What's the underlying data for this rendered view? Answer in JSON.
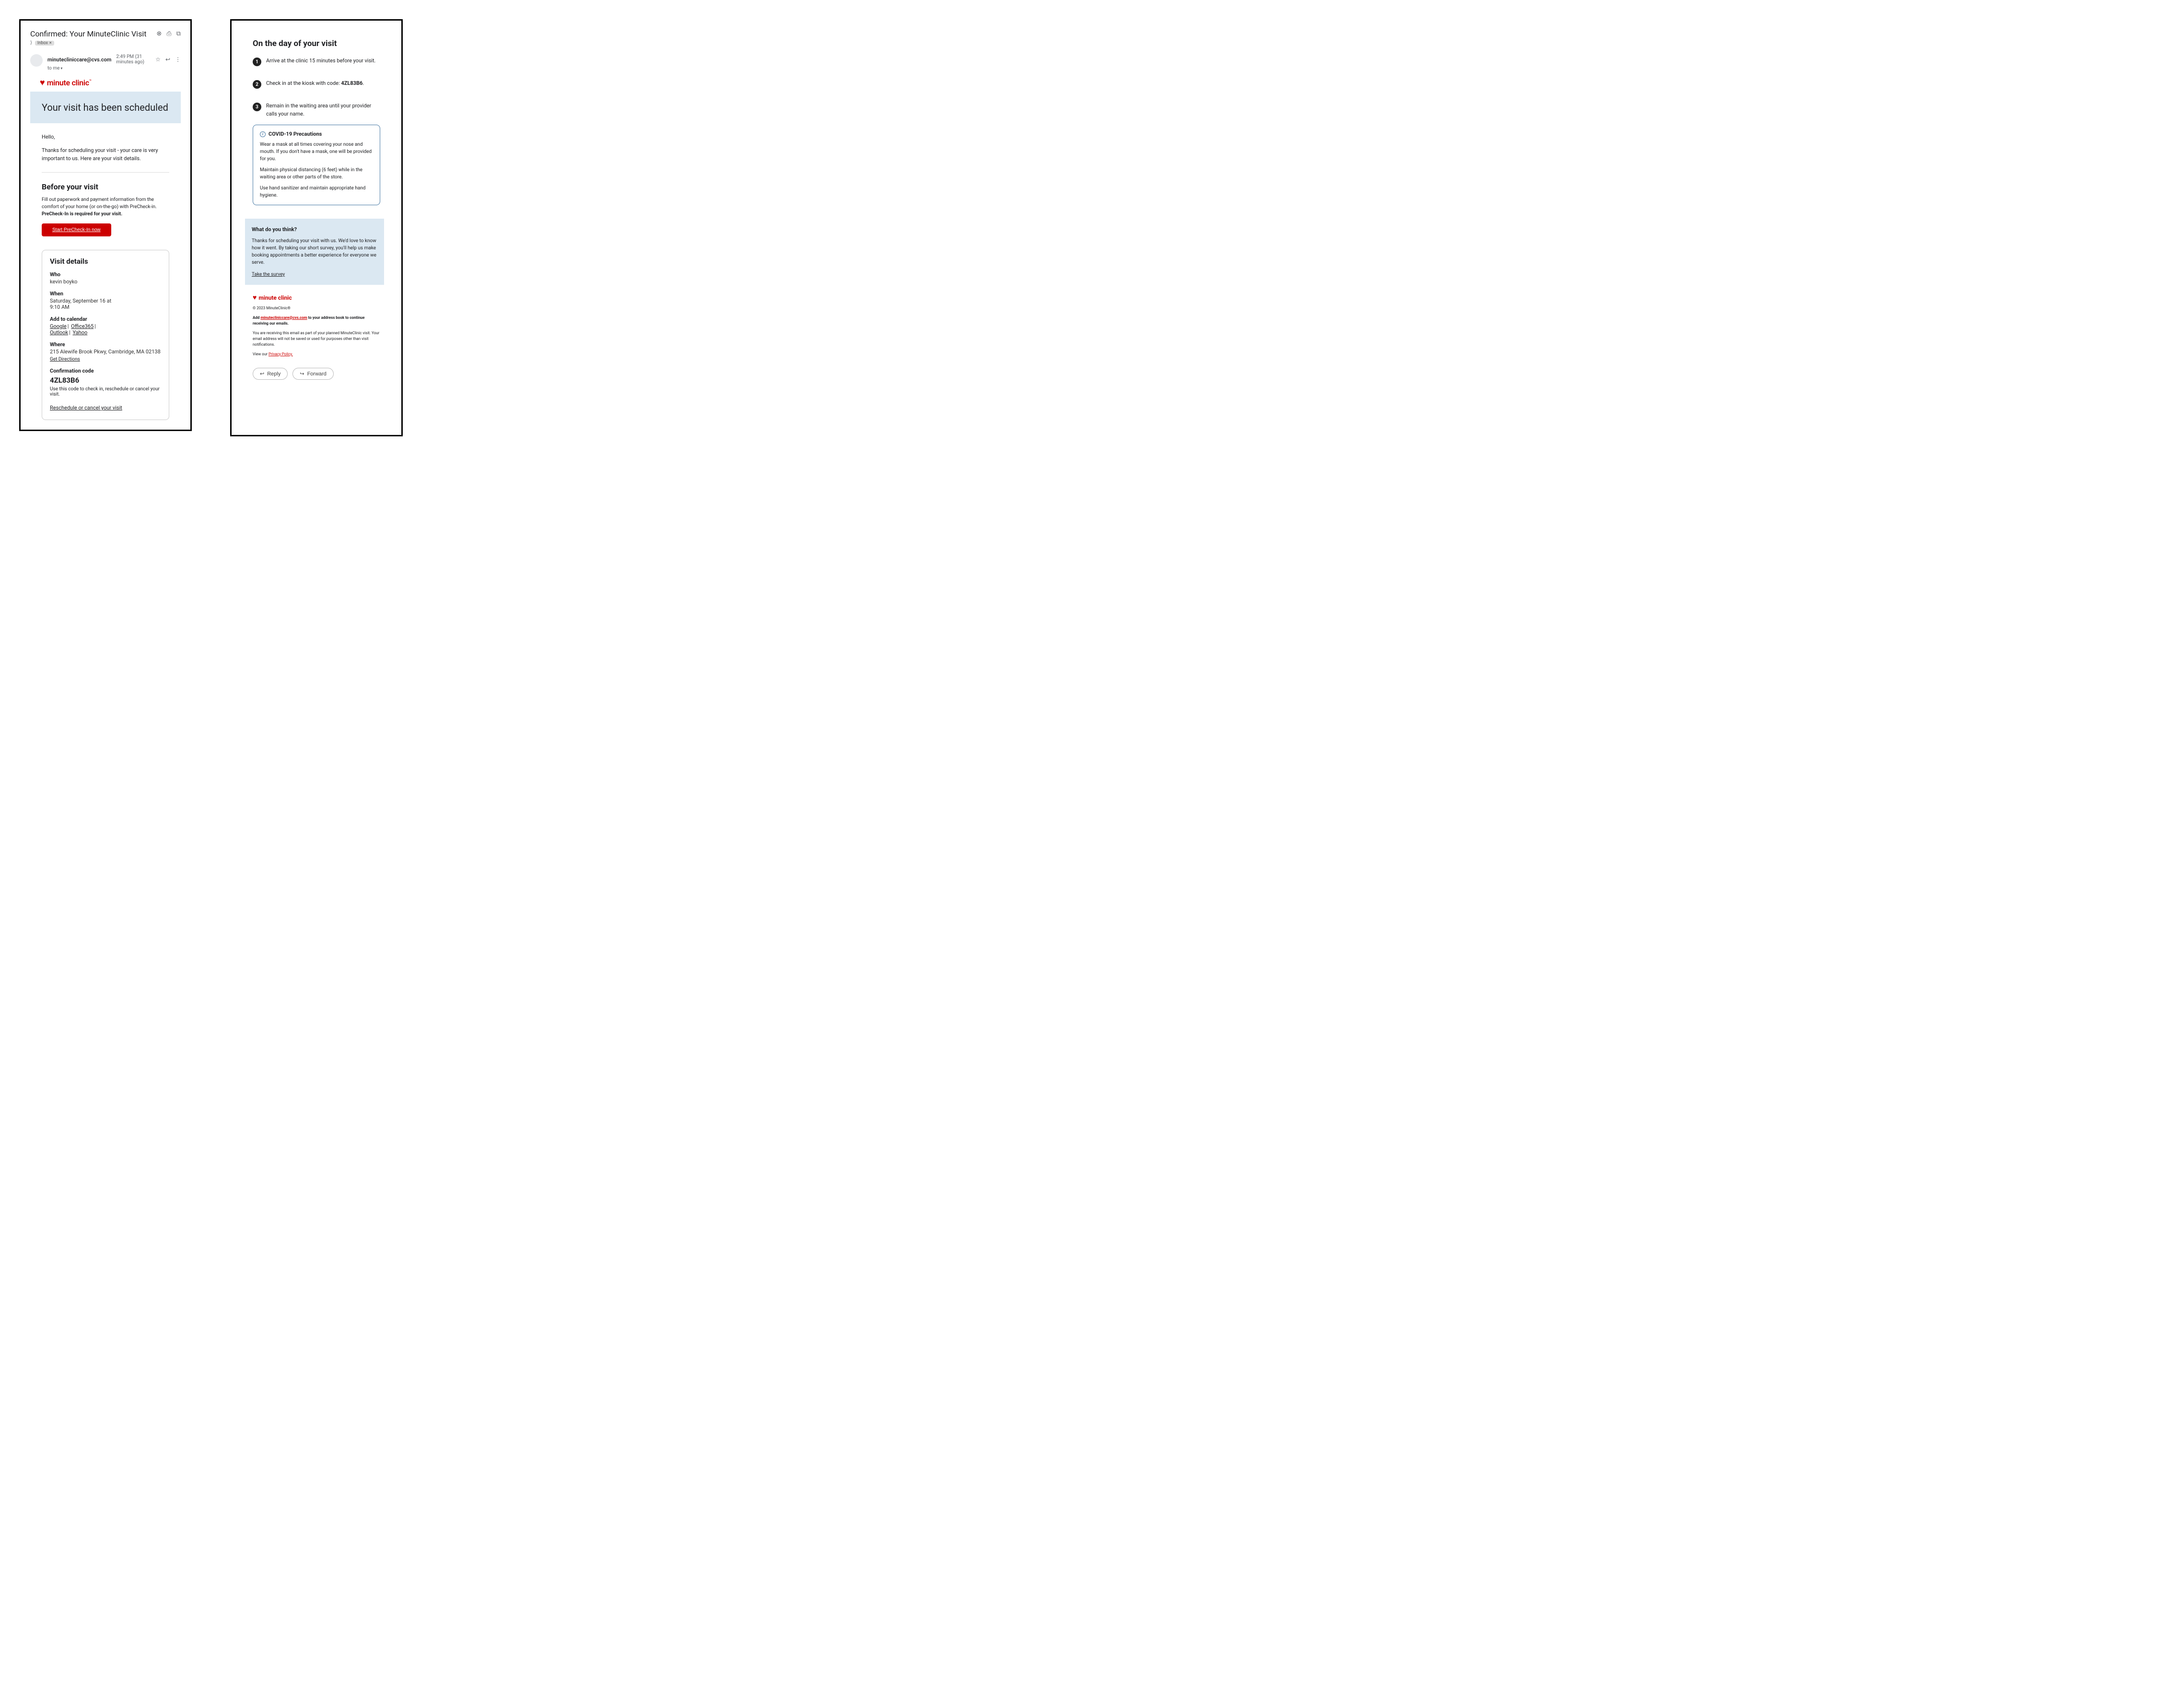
{
  "header": {
    "subject": "Confirmed: Your MinuteClinic Visit",
    "inbox_label": "Inbox",
    "sender_email": "minutecliniccare@cvs.com",
    "timestamp": "2:49 PM (31 minutes ago)",
    "to_line": "to me"
  },
  "brand": {
    "name": "minute clinic",
    "tm": "™"
  },
  "hero": {
    "title": "Your visit has been scheduled"
  },
  "body": {
    "greeting": "Hello,",
    "intro": "Thanks for scheduling your visit - your care is very important to us. Here are your visit details.",
    "before_heading": "Before your visit",
    "before_text_plain": "Fill out paperwork and payment information from the comfort of your home (or on-the-go) with PreCheck-in. ",
    "before_text_bold": "PreCheck-In is required for your visit.",
    "cta_label": "Start PreCheck-In now"
  },
  "details": {
    "heading": "Visit details",
    "who_label": "Who",
    "who_value": "kevin boyko",
    "when_label": "When",
    "when_line1": "Saturday, September 16 at",
    "when_line2": "9:10 AM",
    "calendar_label": "Add to calendar",
    "cal_google": "Google",
    "cal_o365": "Office365",
    "cal_outlook": "Outlook",
    "cal_yahoo": "Yahoo",
    "where_label": "Where",
    "where_value": "215 Alewife Brook Pkwy, Cambridge, MA 02138",
    "directions": "Get Directions",
    "conf_label": "Confirmation code",
    "conf_code": "4ZL83B6",
    "conf_hint": "Use this code to check in, reschedule or cancel your visit.",
    "reschedule": "Reschedule or cancel your visit"
  },
  "dayof": {
    "heading": "On the day of your visit",
    "step1": "Arrive at the clinic 15 minutes before your visit.",
    "step2_a": "Check in at the kiosk with code: ",
    "step2_b": "4ZL83B6",
    "step2_c": ".",
    "step3": "Remain in the waiting area until your provider calls your name."
  },
  "covid": {
    "title": "COVID-19 Precautions",
    "p1": "Wear a mask at all times covering your nose and mouth. If you don't have a mask, one will be provided for you.",
    "p2": "Maintain physical distancing (6 feet) while in the waiting area or other parts of the store.",
    "p3": "Use hand sanitizer and maintain appropriate hand hygiene."
  },
  "survey": {
    "heading": "What do you think?",
    "body": "Thanks for scheduling your visit with us. We'd love to know how it went. By taking our short survey, you'll help us make booking appointments a better experience for everyone we serve.",
    "link": "Take the survey "
  },
  "footer": {
    "copyright": "© 2023 MinuteClinic®",
    "add_a": "Add ",
    "add_email": "minutecliniccare@cvs.com",
    "add_b": " to your address book to continue receiving our emails.",
    "disclaimer": "You are receiving this email as part of your planned MinuteClinic visit. Your email address will not be saved or used for purposes other than visit notifications.",
    "view_a": "View our ",
    "privacy": "Privacy Policy."
  },
  "actions": {
    "reply": "Reply",
    "forward": "Forward"
  }
}
